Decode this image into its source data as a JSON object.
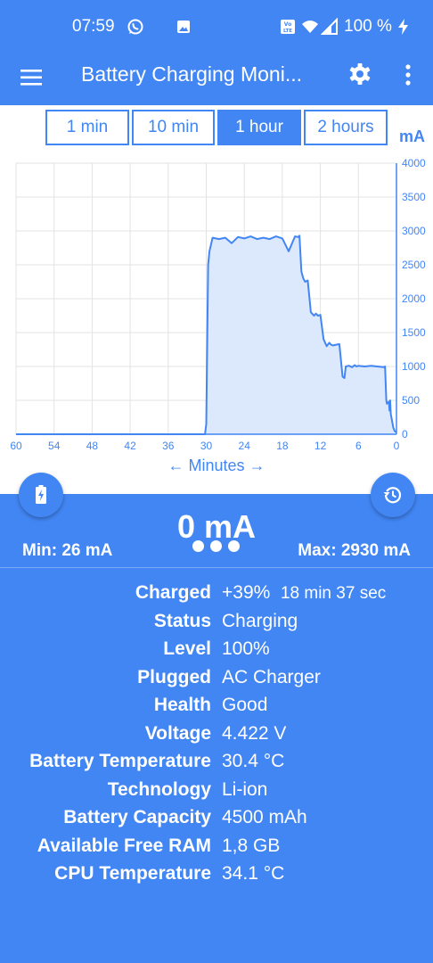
{
  "status_bar": {
    "time": "07:59",
    "battery_text": "100 %"
  },
  "app_bar": {
    "title": "Battery Charging Moni..."
  },
  "ranges": [
    {
      "label": "1 min",
      "active": false
    },
    {
      "label": "10 min",
      "active": false
    },
    {
      "label": "1 hour",
      "active": true
    },
    {
      "label": "2 hours",
      "active": false
    }
  ],
  "chart_data": {
    "type": "area",
    "unit_label": "mA",
    "xlabel": "← Minutes →",
    "xlim": [
      60,
      0
    ],
    "ylim": [
      0,
      4000
    ],
    "x_ticks": [
      "60",
      "54",
      "48",
      "42",
      "36",
      "30",
      "24",
      "18",
      "12",
      "6",
      "0"
    ],
    "y_ticks": [
      "4000",
      "3500",
      "3000",
      "2500",
      "2000",
      "1500",
      "1000",
      "500",
      "0"
    ],
    "grid": true,
    "series": [
      {
        "x": [
          60,
          30.2,
          30.0,
          29.7,
          29.5,
          29.0,
          28.0,
          27.0,
          26.0,
          25.0,
          24.0,
          23.0,
          22.0,
          21.0,
          20.0,
          19.0,
          18.0,
          17.0,
          16.0,
          15.5,
          15.3,
          15.0,
          14.7,
          14.4,
          14.0,
          13.5,
          13.0,
          12.7,
          12.4,
          12.0,
          11.5,
          11.0,
          10.6,
          10.3,
          10.0,
          9.0,
          8.5,
          8.2,
          8.0,
          7.5,
          7.0,
          6.6,
          6.3,
          6.0,
          5.0,
          4.0,
          3.0,
          2.0,
          1.8,
          1.6,
          1.5,
          1.2,
          1.1,
          1.0,
          0.9,
          0.7,
          0.5,
          0.3,
          0
        ],
        "y": [
          0,
          0,
          150,
          2500,
          2700,
          2900,
          2880,
          2900,
          2820,
          2910,
          2890,
          2920,
          2880,
          2900,
          2880,
          2920,
          2890,
          2700,
          2920,
          2910,
          2930,
          2400,
          2300,
          2250,
          2270,
          1800,
          1750,
          1780,
          1750,
          1760,
          1400,
          1300,
          1350,
          1320,
          1310,
          1330,
          850,
          830,
          1000,
          1010,
          990,
          1020,
          1000,
          1010,
          1000,
          1010,
          1000,
          990,
          1000,
          500,
          450,
          480,
          350,
          500,
          300,
          200,
          100,
          50,
          26
        ]
      }
    ]
  },
  "fab_left": "battery-charging-icon",
  "fab_right": "history-icon",
  "current": {
    "value": "0 mA",
    "min": "Min: 26 mA",
    "max": "Max: 2930 mA"
  },
  "info": [
    {
      "label": "Charged",
      "value": "+39%",
      "extra": "18 min 37 sec"
    },
    {
      "label": "Status",
      "value": "Charging"
    },
    {
      "label": "Level",
      "value": "100%"
    },
    {
      "label": "Plugged",
      "value": "AC Charger"
    },
    {
      "label": "Health",
      "value": "Good"
    },
    {
      "label": "Voltage",
      "value": "4.422 V"
    },
    {
      "label": "Battery Temperature",
      "value": "30.4 °C"
    },
    {
      "label": "Technology",
      "value": "Li-ion"
    },
    {
      "label": "Battery Capacity",
      "value": "4500 mAh"
    },
    {
      "label": "Available Free RAM",
      "value": "1,8 GB"
    },
    {
      "label": "CPU Temperature",
      "value": "34.1 °C"
    }
  ],
  "colors": {
    "accent": "#4286f4",
    "fill": "#dce8fb",
    "grid": "#e3e3e3"
  }
}
